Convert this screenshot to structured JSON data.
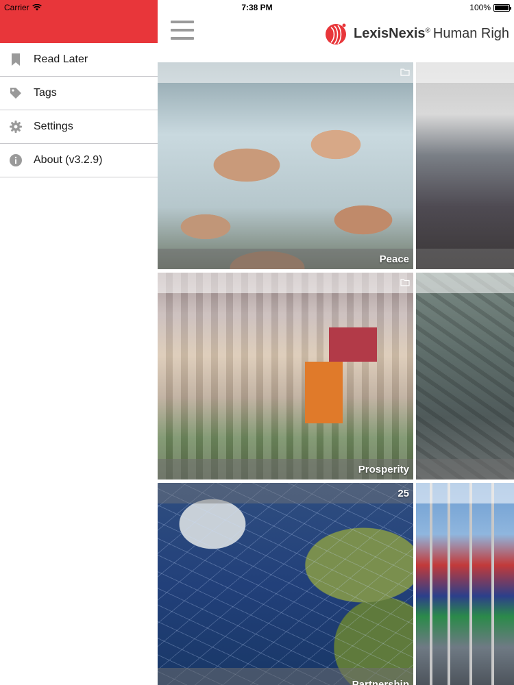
{
  "status_bar": {
    "carrier": "Carrier",
    "time": "7:38 PM",
    "battery": "100%"
  },
  "sidebar": {
    "header_color": "#e8363a",
    "items": [
      {
        "label": "Read Later",
        "icon": "bookmark-icon"
      },
      {
        "label": "Tags",
        "icon": "tag-icon"
      },
      {
        "label": "Settings",
        "icon": "gear-icon"
      },
      {
        "label": "About (v3.2.9)",
        "icon": "info-icon"
      }
    ]
  },
  "header": {
    "brand_name": "LexisNexis",
    "brand_reg": "®",
    "brand_suffix": "Human Righ"
  },
  "tiles": [
    {
      "label": "Peace",
      "badge": "folder-icon"
    },
    {
      "label": "",
      "badge": ""
    },
    {
      "label": "Prosperity",
      "badge": "folder-icon"
    },
    {
      "label": "",
      "badge": ""
    },
    {
      "label": "Partnership",
      "count": "25"
    },
    {
      "label": "",
      "badge": ""
    }
  ]
}
